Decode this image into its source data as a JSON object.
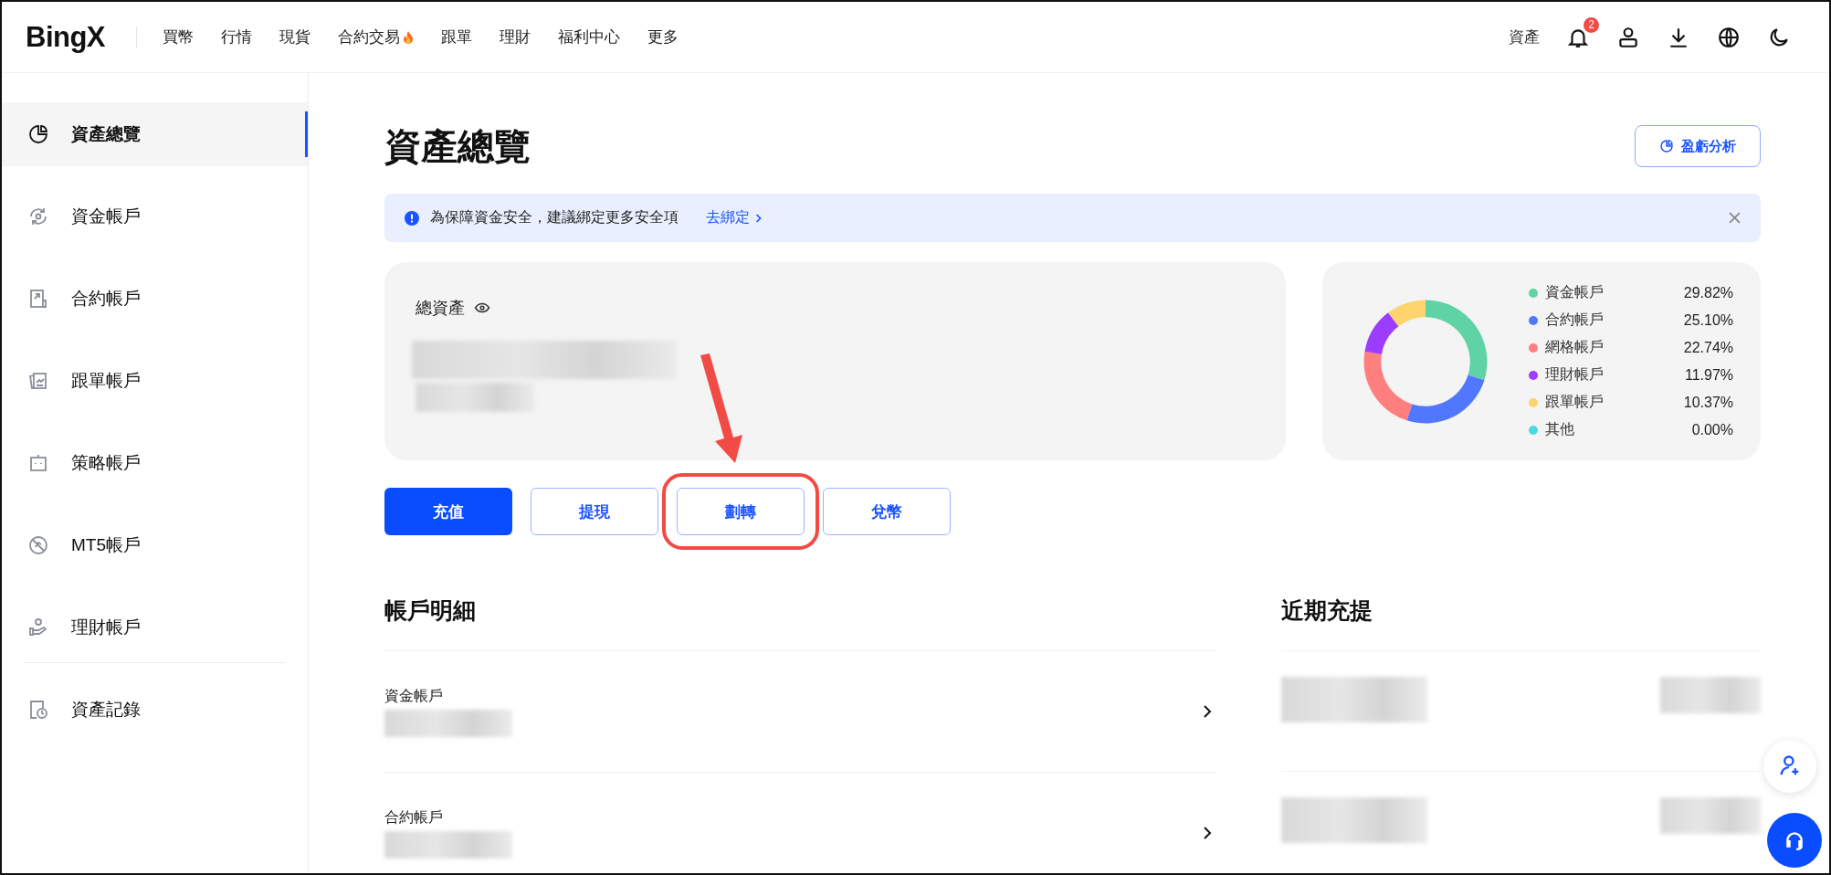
{
  "header": {
    "logo": "BingX",
    "nav": [
      {
        "label": "買幣",
        "hot": false
      },
      {
        "label": "行情",
        "hot": false
      },
      {
        "label": "現貨",
        "hot": false
      },
      {
        "label": "合約交易",
        "hot": true
      },
      {
        "label": "跟單",
        "hot": false
      },
      {
        "label": "理財",
        "hot": false
      },
      {
        "label": "福利中心",
        "hot": false
      },
      {
        "label": "更多",
        "hot": false
      }
    ],
    "assets_link": "資產",
    "notification_count": "2"
  },
  "sidebar": {
    "items": [
      {
        "label": "資產總覽",
        "selected": true
      },
      {
        "label": "資金帳戶",
        "selected": false
      },
      {
        "label": "合約帳戶",
        "selected": false
      },
      {
        "label": "跟單帳戶",
        "selected": false
      },
      {
        "label": "策略帳戶",
        "selected": false
      },
      {
        "label": "MT5帳戶",
        "selected": false
      },
      {
        "label": "理財帳戶",
        "selected": false
      }
    ],
    "footer_item": {
      "label": "資產記錄",
      "selected": false
    }
  },
  "page": {
    "title": "資產總覽",
    "profit_button": "盈虧分析"
  },
  "banner": {
    "message": "為保障資金安全，建議綁定更多安全項",
    "link": "去綁定"
  },
  "total": {
    "label": "總資產"
  },
  "distribution": {
    "legend": [
      {
        "percent": "29.82%",
        "color": "#5fd3a5"
      },
      {
        "percent": "25.10%",
        "color": "#5177ff"
      },
      {
        "percent": "22.74%",
        "color": "#ff7f7f"
      },
      {
        "percent": "11.97%",
        "color": "#9b3cff"
      },
      {
        "percent": "10.37%",
        "color": "#ffd36e"
      },
      {
        "percent": "0.00%",
        "color": "#4dd9e3"
      }
    ],
    "chart_data": {
      "type": "donut",
      "categories": [
        "資金帳戶",
        "合約帳戶",
        "網格帳戶",
        "理財帳戶",
        "跟單帳戶",
        "其他"
      ],
      "values": [
        29.82,
        25.1,
        22.74,
        11.97,
        10.37,
        0
      ]
    }
  },
  "actions": [
    {
      "label": "充值",
      "kind": "primary"
    },
    {
      "label": "提現",
      "kind": "outline"
    },
    {
      "label": "劃轉",
      "kind": "outline",
      "highlighted": true
    },
    {
      "label": "兌幣",
      "kind": "outline"
    }
  ],
  "account_details": {
    "title": "帳戶明細",
    "rows": [
      {
        "name": "資金帳戶"
      },
      {
        "name": "合約帳戶"
      }
    ]
  },
  "recent": {
    "title": "近期充提"
  }
}
